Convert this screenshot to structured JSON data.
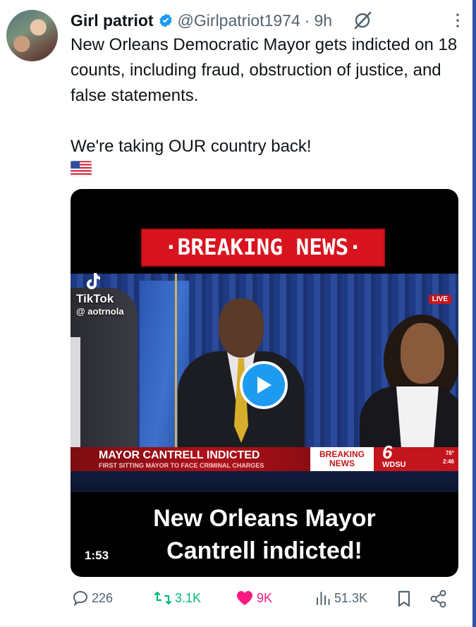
{
  "author": {
    "display_name": "Girl patriot",
    "handle": "@Girlpatriot1974",
    "separator": "·",
    "time_ago": "9h"
  },
  "tweet": {
    "paragraph_1": "New Orleans Democratic Mayor gets indicted on 18 counts, including fraud, obstruction of justice,  and false statements.",
    "paragraph_2": "We're taking OUR country back!",
    "flag_emoji": "us-flag-icon"
  },
  "media": {
    "banner_text": "·BREAKING NEWS·",
    "live_badge": "LIVE",
    "tiktok_label": "TikTok",
    "tiktok_user": "@ aotrnola",
    "lower_third_headline": "MAYOR CANTRELL INDICTED",
    "lower_third_sub": "FIRST SITTING MAYOR TO FACE CRIMINAL CHARGES",
    "breaking_line1": "BREAKING",
    "breaking_line2": "NEWS",
    "station_number": "6",
    "station_name": "WDSU",
    "station_temp": "78°",
    "station_time": "2:46",
    "caption_line1": "New Orleans Mayor",
    "caption_line2": "Cantrell indicted!",
    "duration": "1:53"
  },
  "actions": {
    "replies": "226",
    "reposts": "3.1K",
    "likes": "9K",
    "views": "51.3K"
  },
  "colors": {
    "accent_blue": "#1d9bf0",
    "repost_green": "#00ba7c",
    "like_pink": "#f91880",
    "muted_text": "#536471"
  }
}
